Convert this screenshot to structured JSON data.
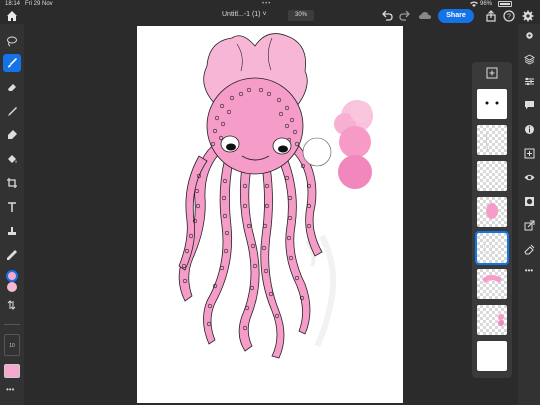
{
  "status_bar": {
    "time": "18:14",
    "date": "Fri 29 Nov",
    "battery": "96%",
    "battery_level": 0.96
  },
  "top_bar": {
    "document_title": "Untitl...-1 (1) ˅",
    "zoom": "30%",
    "share_label": "Share"
  },
  "left_toolbar": {
    "tools": [
      "lasso-icon",
      "brush-icon",
      "eraser-icon",
      "smudge-icon",
      "blur-icon",
      "fill-icon",
      "crop-icon",
      "text-icon",
      "stamp-icon",
      "eyedropper-icon"
    ],
    "active_tool": "brush-icon",
    "brush_size": "10",
    "primary_color": "#f7a8cf",
    "secondary_color": "#f5b8d5",
    "swatch_color": "#f7a8cf"
  },
  "right_toolbar": {
    "tools": [
      "gear-icon",
      "layers-icon",
      "adjustments-icon",
      "comment-icon",
      "info-icon",
      "add-layer-icon",
      "visibility-icon",
      "mask-icon",
      "import-icon",
      "eraser-layer-icon",
      "more-icon"
    ]
  },
  "layers": {
    "count": 8,
    "selected_index": 4
  },
  "colors": {
    "accent": "#1473e6",
    "jellyfish_pink": "#f59cc9",
    "jellyfish_light": "#f8b6d6",
    "outline": "#222222"
  }
}
